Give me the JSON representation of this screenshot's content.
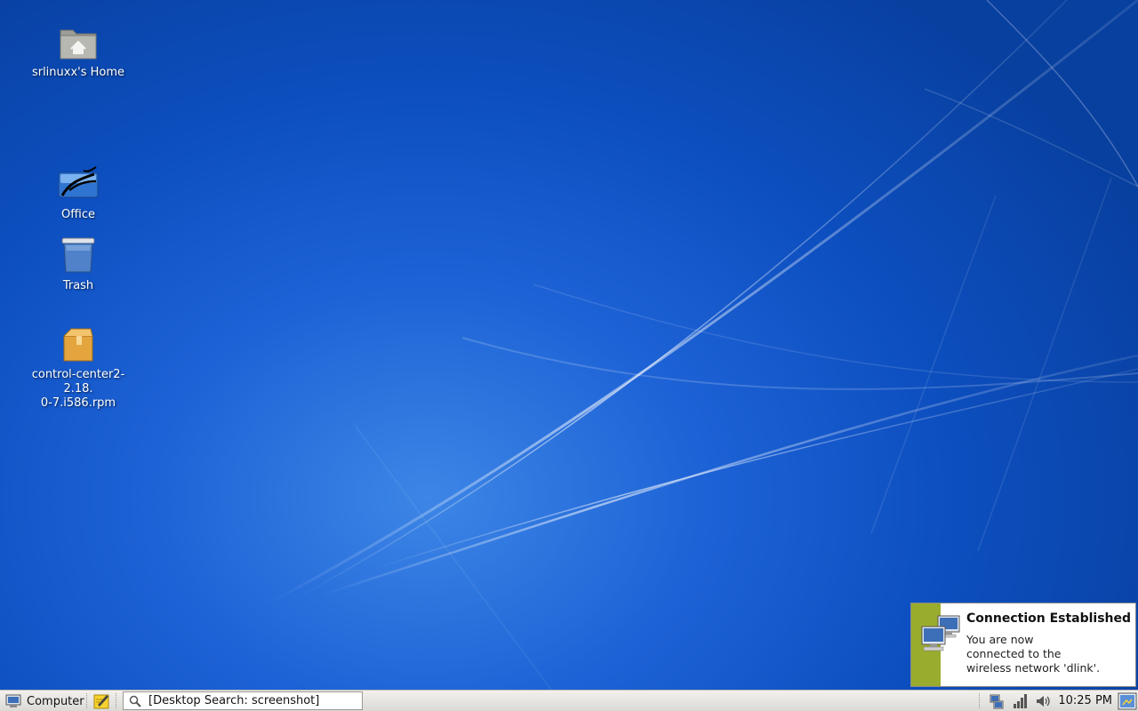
{
  "desktop": {
    "icons": [
      {
        "label": "srlinuxx's Home",
        "icon": "home-folder-icon"
      },
      {
        "label": "Office",
        "icon": "office-icon"
      },
      {
        "label": "Trash",
        "icon": "trash-icon"
      },
      {
        "label_line1": "control-center2-2.18.",
        "label_line2": "0-7.i586.rpm",
        "icon": "package-icon"
      }
    ]
  },
  "notification": {
    "title": "Connection Established",
    "body_line1": "You are now",
    "body_line2": "connected to the",
    "body_line3": "wireless network 'dlink'.",
    "icon": "network-computers-icon",
    "stripe_color": "#9aac2e"
  },
  "panel": {
    "menu_label": "Computer",
    "search_value": "[Desktop Search: screenshot]",
    "clock": "10:25 PM",
    "tray_icons": [
      "network-manager-icon",
      "signal-strength-icon",
      "volume-icon",
      "show-desktop-icon"
    ]
  },
  "colors": {
    "desktop_blue": "#1d62d6",
    "panel_bg": "#e6e4df"
  }
}
